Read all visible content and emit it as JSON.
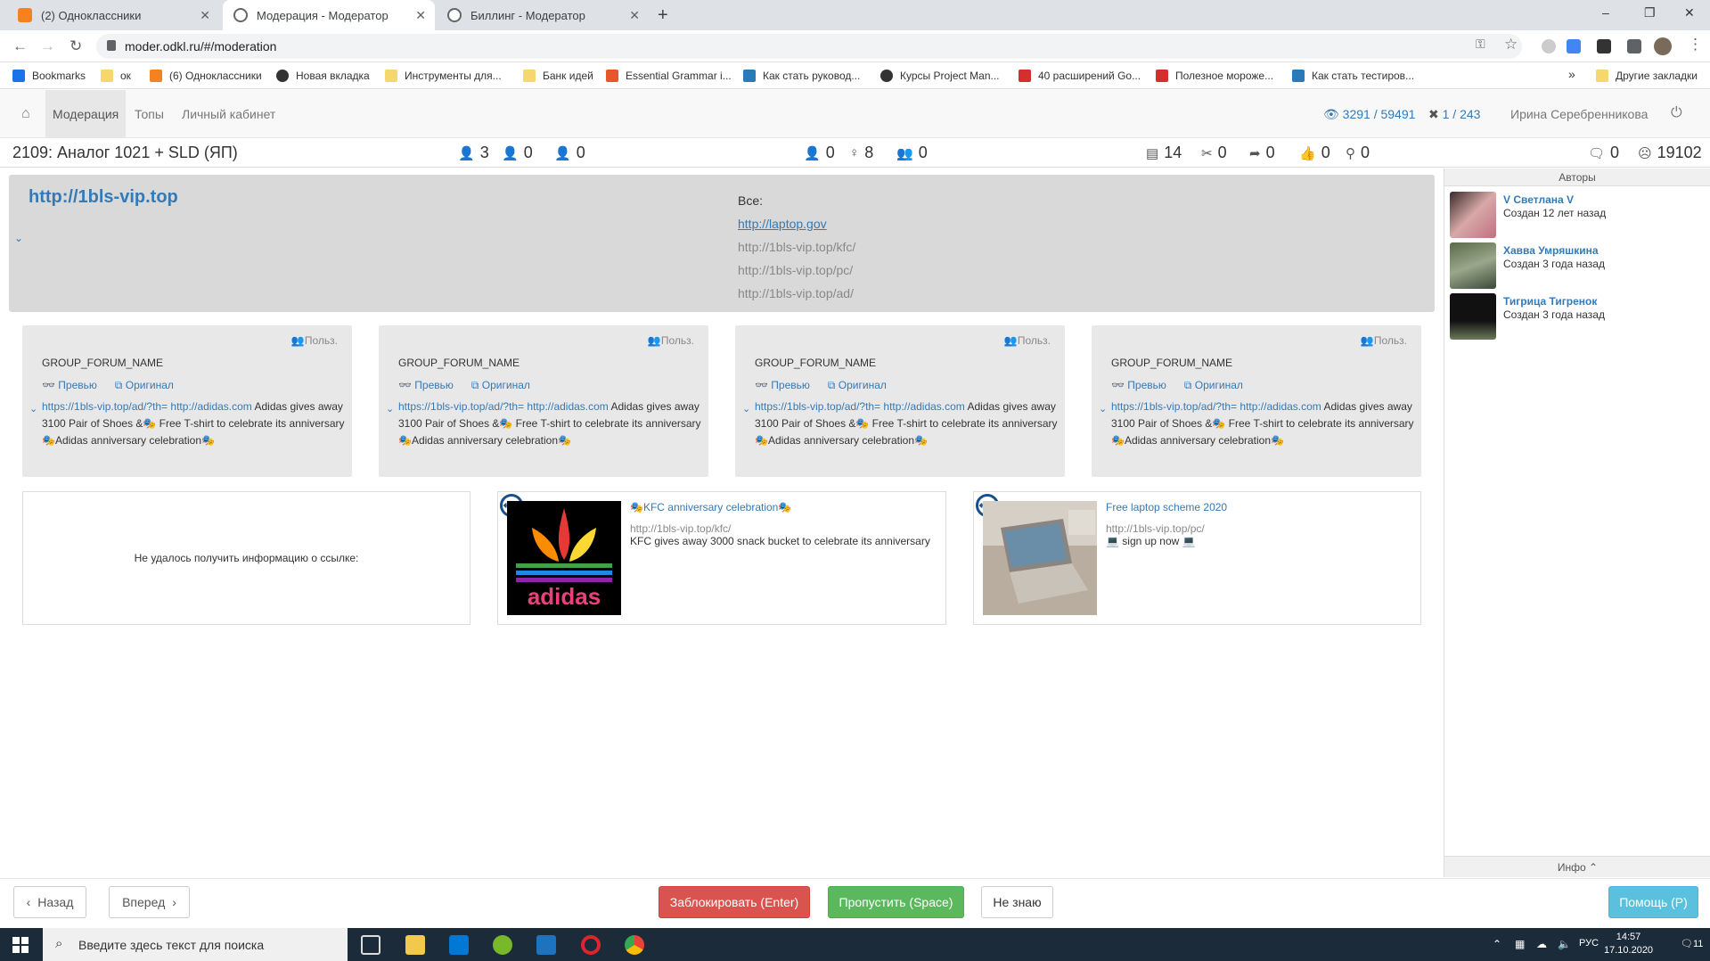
{
  "browser": {
    "tabs": [
      {
        "title": "(2) Одноклассники",
        "favicon_color": "#f58220"
      },
      {
        "title": "Модерация - Модератор",
        "favicon_color": "#666666"
      },
      {
        "title": "Биллинг - Модератор",
        "favicon_color": "#666666"
      }
    ],
    "new_tab": "+",
    "win_min": "–",
    "win_max": "❐",
    "win_close": "✕",
    "url": "moder.odkl.ru/#/moderation",
    "bookmarks": [
      {
        "label": "Bookmarks",
        "color": "#1a73e8"
      },
      {
        "label": "ок",
        "color": "#f5d76e"
      },
      {
        "label": "(6) Одноклассники",
        "color": "#f58220"
      },
      {
        "label": "Новая вкладка",
        "color": "#333333"
      },
      {
        "label": "Инструменты для...",
        "color": "#f5d76e"
      },
      {
        "label": "Банк идей",
        "color": "#f5d76e"
      },
      {
        "label": "Essential Grammar i...",
        "color": "#e8572a"
      },
      {
        "label": "Как стать руковод...",
        "color": "#2a7ab8"
      },
      {
        "label": "Курсы Project Man...",
        "color": "#333333"
      },
      {
        "label": "40 расширений Go...",
        "color": "#d32f2f"
      },
      {
        "label": "Полезное мороже...",
        "color": "#d32f2f"
      },
      {
        "label": "Как стать тестиров...",
        "color": "#2a7ab8"
      }
    ],
    "other_bookmarks": "Другие закладки",
    "more": "»"
  },
  "topnav": {
    "items": [
      "Модерация",
      "Топы",
      "Личный кабинет"
    ],
    "views": "3291 / 59491",
    "blocked": "1 / 243",
    "user": "Ирина Серебренникова"
  },
  "stats": {
    "title": "2109: Аналог 1021 + SLD (ЯП)",
    "left": [
      "3",
      "0",
      "0"
    ],
    "mid": [
      "0",
      "8",
      "0"
    ],
    "right": [
      "14",
      "0",
      "0",
      "0",
      "0"
    ],
    "far": [
      "0",
      "19102"
    ]
  },
  "header": {
    "url": "http://1bls-vip.top",
    "all_label": "Все:",
    "all_links": [
      "http://laptop.gov",
      "http://1bls-vip.top/kfc/",
      "http://1bls-vip.top/pc/",
      "http://1bls-vip.top/ad/"
    ]
  },
  "cards": [
    {
      "polz": "Польз.",
      "group": "GROUP_FORUM_NAME",
      "preview": "Превью",
      "original": "Оригинал",
      "link": "https://1bls-vip.top/ad/?th= http://adidas.com",
      "text": " Adidas gives away 3100 Pair of Shoes &🎭 Free T-shirt to celebrate its anniversary 🎭Adidas anniversary celebration🎭"
    },
    {
      "polz": "Польз.",
      "group": "GROUP_FORUM_NAME",
      "preview": "Превью",
      "original": "Оригинал",
      "link": "https://1bls-vip.top/ad/?th= http://adidas.com",
      "text": " Adidas gives away 3100 Pair of Shoes &🎭 Free T-shirt to celebrate its anniversary 🎭Adidas anniversary celebration🎭"
    },
    {
      "polz": "Польз.",
      "group": "GROUP_FORUM_NAME",
      "preview": "Превью",
      "original": "Оригинал",
      "link": "https://1bls-vip.top/ad/?th= http://adidas.com",
      "text": " Adidas gives away 3100 Pair of Shoes &🎭 Free T-shirt to celebrate its anniversary 🎭Adidas anniversary celebration🎭"
    },
    {
      "polz": "Польз.",
      "group": "GROUP_FORUM_NAME",
      "preview": "Превью",
      "original": "Оригинал",
      "link": "https://1bls-vip.top/ad/?th= http://adidas.com",
      "text": " Adidas gives away 3100 Pair of Shoes &🎭 Free T-shirt to celebrate its anniversary 🎭Adidas anniversary celebration🎭"
    }
  ],
  "previews": {
    "error": "Не удалось получить информацию о ссылке:",
    "kfc": {
      "title": "🎭KFC anniversary celebration🎭",
      "url": "http://1bls-vip.top/kfc/",
      "desc": "KFC gives away 3000 snack bucket to celebrate its anniversary"
    },
    "pc": {
      "title": "Free laptop scheme 2020",
      "url": "http://1bls-vip.top/pc/",
      "desc": "💻 sign up now 💻"
    }
  },
  "sidebar": {
    "header": "Авторы",
    "authors": [
      {
        "name": "V Светлана V",
        "created": "Создан 12 лет назад"
      },
      {
        "name": "Хавва Умряшкина",
        "created": "Создан 3 года назад"
      },
      {
        "name": "Тигрица Тигренок",
        "created": "Создан 3 года назад"
      }
    ],
    "info": "Инфо ⌃"
  },
  "footer": {
    "back": "Назад",
    "forward": "Вперед",
    "block": "Заблокировать (Enter)",
    "skip": "Пропустить (Space)",
    "dunno": "Не знаю",
    "help": "Помощь (P)"
  },
  "taskbar": {
    "search_placeholder": "Введите здесь текст для поиска",
    "lang": "РУС",
    "time": "14:57",
    "date": "17.10.2020",
    "notif": "11"
  }
}
